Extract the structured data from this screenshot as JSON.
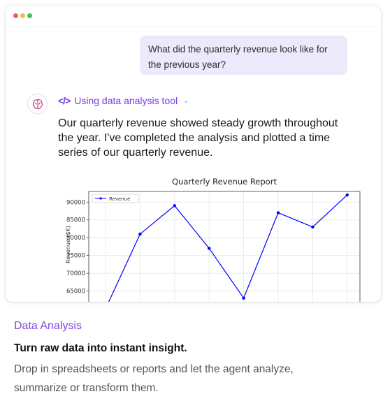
{
  "user_message": "What did the quarterly revenue look like for the previous year?",
  "tool": {
    "label": "Using data analysis tool",
    "icon": "code-icon"
  },
  "assistant_message": "Our quarterly revenue showed steady growth throughout the year. I've completed the analysis and plotted a time series of our quarterly revenue.",
  "colors": {
    "accent": "#7c3aed",
    "series": "#0000ff",
    "user_bubble": "#ede9fc"
  },
  "chart_data": {
    "type": "line",
    "title": "Quarterly Revenue Report",
    "ylabel": "Revenue ($K)",
    "xlabel": "",
    "ylim": [
      60000,
      93000
    ],
    "yticks": [
      65000,
      70000,
      75000,
      80000,
      85000,
      90000
    ],
    "grid": true,
    "legend": "top-left",
    "series": [
      {
        "name": "Revenue",
        "values": [
          60000,
          81000,
          89000,
          77000,
          63000,
          87000,
          83000,
          92000
        ]
      }
    ]
  },
  "caption": {
    "category": "Data Analysis",
    "headline": "Turn raw data into instant insight.",
    "body": "Drop in spreadsheets or reports and let the agent analyze, summarize or transform them."
  }
}
